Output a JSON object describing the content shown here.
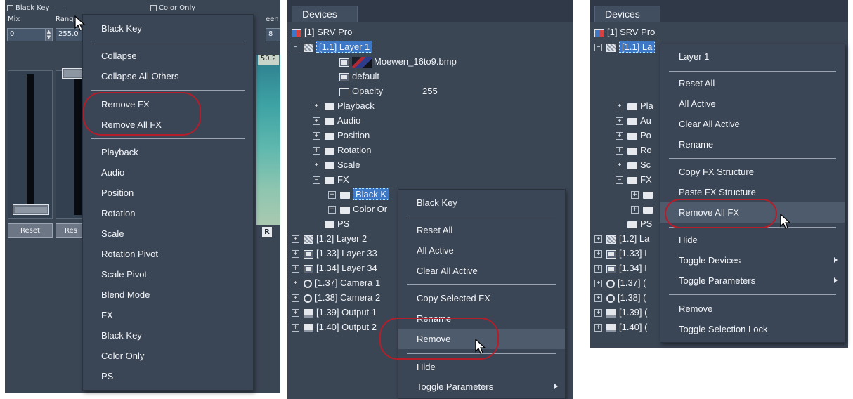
{
  "panel_fx": {
    "groups": [
      "Black Key",
      "Color Only"
    ],
    "headers": [
      "Mix",
      "Range",
      "een"
    ],
    "mix_value": "0",
    "range_value": "255.0",
    "partial_value": "8",
    "image_label": "50.2",
    "reset_label": "Reset",
    "reset_partial": "Res",
    "r_button": "R",
    "menu": {
      "title": "Black Key",
      "items_a": [
        "Collapse",
        "Collapse All Others"
      ],
      "items_b": [
        "Remove FX",
        "Remove All FX"
      ],
      "items_c": [
        "Playback",
        "Audio",
        "Position",
        "Rotation",
        "Scale",
        "Rotation Pivot",
        "Scale Pivot",
        "Blend Mode",
        "FX",
        "Black Key",
        "Color Only",
        "PS"
      ]
    }
  },
  "panel_devices_a": {
    "tab": "Devices",
    "rows": {
      "device": "[1] SRV Pro",
      "layer": "[1.1] Layer 1",
      "media": "Moewen_16to9.bmp",
      "default": "default",
      "opacity_label": "Opacity",
      "opacity_value": "255",
      "playback": "Playback",
      "audio": "Audio",
      "position": "Position",
      "rotation": "Rotation",
      "scale": "Scale",
      "fx": "FX",
      "black_key": "Black K",
      "color_only": "Color Or",
      "ps": "PS",
      "layer2": "[1.2] Layer 2",
      "layer33": "[1.33] Layer 33",
      "layer34": "[1.34] Layer 34",
      "camera1": "[1.37] Camera 1",
      "camera2": "[1.38] Camera 2",
      "output1": "[1.39] Output 1",
      "output2": "[1.40] Output 2"
    },
    "menu": {
      "title": "Black Key",
      "items_a": [
        "Reset All",
        "All Active",
        "Clear All Active"
      ],
      "items_b": [
        "Copy Selected FX",
        "Rename",
        "Remove"
      ],
      "items_c": [
        "Hide",
        "Toggle Parameters"
      ]
    }
  },
  "panel_devices_b": {
    "tab": "Devices",
    "rows": {
      "device": "[1] SRV Pro",
      "layer": "[1.1] La",
      "playback": "Pla",
      "audio": "Au",
      "position": "Po",
      "rotation": "Ro",
      "scale": "Sc",
      "fx": "FX",
      "ps": "PS",
      "layer2": "[1.2] La",
      "layer33": "[1.33] I",
      "layer34": "[1.34] I",
      "camera1": "[1.37] (",
      "camera2": "[1.38] (",
      "output1": "[1.39] (",
      "output2": "[1.40] ("
    },
    "menu": {
      "title": "Layer 1",
      "items_a": [
        "Reset All",
        "All Active",
        "Clear All Active",
        "Rename"
      ],
      "items_b": [
        "Copy FX Structure",
        "Paste FX Structure",
        "Remove All FX"
      ],
      "items_c": [
        "Hide",
        "Toggle Devices",
        "Toggle Parameters"
      ],
      "items_d": [
        "Remove",
        "Toggle Selection Lock"
      ]
    }
  },
  "colors": {
    "panel_bg": "#3b4655",
    "highlight": "#3d78c7",
    "annotation_ring": "#b41e2a"
  }
}
